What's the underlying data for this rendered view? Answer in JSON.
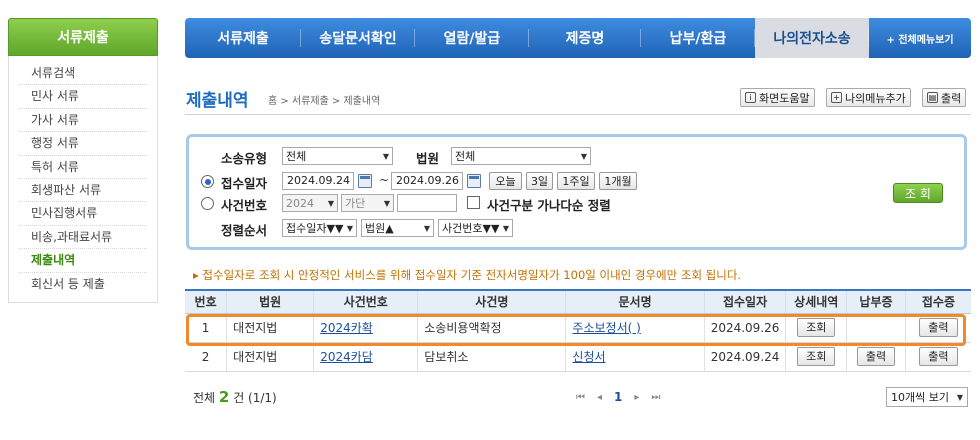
{
  "sidebar": {
    "header": "서류제출",
    "items": [
      "서류검색",
      "민사 서류",
      "가사 서류",
      "행정 서류",
      "특허 서류",
      "회생파산 서류",
      "민사집행서류",
      "비송,과태료서류",
      "제출내역",
      "회신서 등 제출"
    ],
    "active_index": 8
  },
  "topnav": {
    "items": [
      "서류제출",
      "송달문서확인",
      "열람/발급",
      "제증명",
      "납부/환급",
      "나의전자소송"
    ],
    "all_menu": "+ 전체메뉴보기",
    "active_index": 5
  },
  "page": {
    "title": "제출내역",
    "breadcrumb": "홈 > 서류제출 > 제출내역",
    "help_btn": "화면도움말",
    "mymenu_btn": "나의메뉴추가",
    "print_btn": "출력"
  },
  "search": {
    "case_type_label": "소송유형",
    "case_type_value": "전체",
    "court_label": "법원",
    "court_value": "전체",
    "receipt_date_label": "접수일자",
    "date_from": "2024.09.24",
    "date_sep": "~",
    "date_to": "2024.09.26",
    "quick_ranges": [
      "오늘",
      "3일",
      "1주일",
      "1개월"
    ],
    "case_no_label": "사건번호",
    "year_value": "2024",
    "case_kind_value": "가단",
    "case_no_value": "",
    "sort_checkbox_label": "사건구분 가나다순 정렬",
    "order_label": "정렬순서",
    "order_1": "접수일자▼▼",
    "order_2": "법원▲",
    "order_3": "사건번호▼▼",
    "search_btn": "조 회"
  },
  "notice": "▸ 접수일자로 조회 시 안정적인 서비스를 위해 접수일자 기준 전자서명일자가 100일 이내인 경우에만 조회 됩니다.",
  "table": {
    "headers": [
      "번호",
      "법원",
      "사건번호",
      "사건명",
      "문서명",
      "접수일자",
      "상세내역",
      "납부증",
      "접수증"
    ],
    "rows": [
      {
        "no": "1",
        "court": "대전지법",
        "case_no": "2024카확",
        "case_name": "소송비용액확정",
        "doc": "주소보정서(         )",
        "date": "2024.09.26",
        "detail": "조회",
        "pay": "",
        "receipt": "출력"
      },
      {
        "no": "2",
        "court": "대전지법",
        "case_no": "2024카담",
        "case_name": "담보취소",
        "doc": "신청서",
        "date": "2024.09.24",
        "detail": "조회",
        "pay": "출력",
        "receipt": "출력"
      }
    ]
  },
  "footer": {
    "total_prefix": "전체",
    "total_count": "2",
    "total_suffix": "건 (1/1)",
    "pager_first": "⏮",
    "pager_prev": "◂",
    "current_page": "1",
    "pager_next": "▸",
    "pager_last": "⏭",
    "per_page": "10개씩 보기"
  },
  "colors": {
    "accent_green": "#5fa72a",
    "nav_blue": "#1f63b5",
    "highlight_orange": "#f08a2a"
  }
}
